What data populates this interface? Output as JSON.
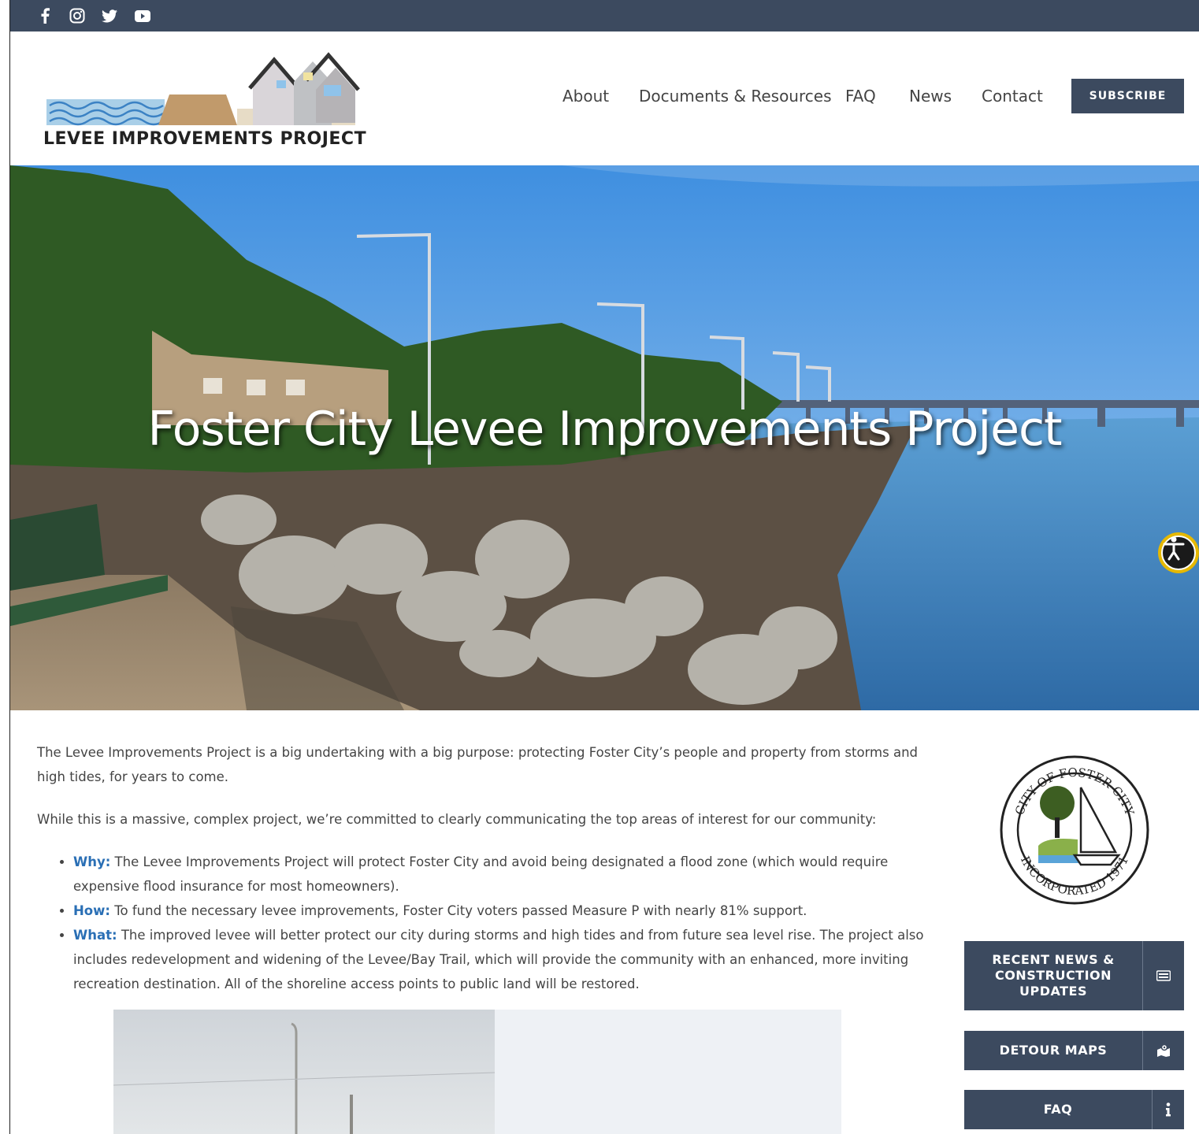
{
  "topbar": {
    "social": [
      "facebook-icon",
      "instagram-icon",
      "twitter-icon",
      "youtube-icon"
    ]
  },
  "header": {
    "logo_text": "LEVEE IMPROVEMENTS PROJECT",
    "nav": [
      "About",
      "Documents & Resources",
      "FAQ",
      "News",
      "Contact"
    ],
    "subscribe_label": "SUBSCRIBE"
  },
  "hero": {
    "title": "Foster City Levee Improvements Project"
  },
  "main": {
    "intro": "The Levee Improvements Project is a big undertaking with a big purpose: protecting Foster City’s people and property from storms and high tides, for years to come.",
    "commitment": "While this is a massive, complex project, we’re committed to clearly communicating the top areas of interest for our community:",
    "bullets": [
      {
        "key": "Why:",
        "text": " The Levee Improvements Project will protect Foster City and avoid being designated a flood zone (which would require expensive flood insurance for most homeowners)."
      },
      {
        "key": "How:",
        "text": " To fund the necessary levee improvements, Foster City voters passed Measure P with nearly 81% support."
      },
      {
        "key": "What:",
        "text": " The improved levee will better protect our city during storms and high tides and from future sea level rise. The project also includes redevelopment and widening of the Levee/Bay Trail, which will provide the community with an enhanced, more inviting recreation destination. All of the shoreline access points to public land will be restored."
      }
    ]
  },
  "sidebar": {
    "seal_top": "CITY OF FOSTER CITY",
    "seal_bottom": "INCORPORATED 1971",
    "buttons": [
      {
        "label": "RECENT NEWS & CONSTRUCTION UPDATES",
        "icon": "newspaper-icon"
      },
      {
        "label": "DETOUR MAPS",
        "icon": "map-marker-icon"
      },
      {
        "label": "FAQ",
        "icon": "info-icon"
      }
    ]
  },
  "colors": {
    "navy": "#3c4a5f",
    "link_blue": "#2a6fb5",
    "accessibility_yellow": "#e6b800"
  }
}
